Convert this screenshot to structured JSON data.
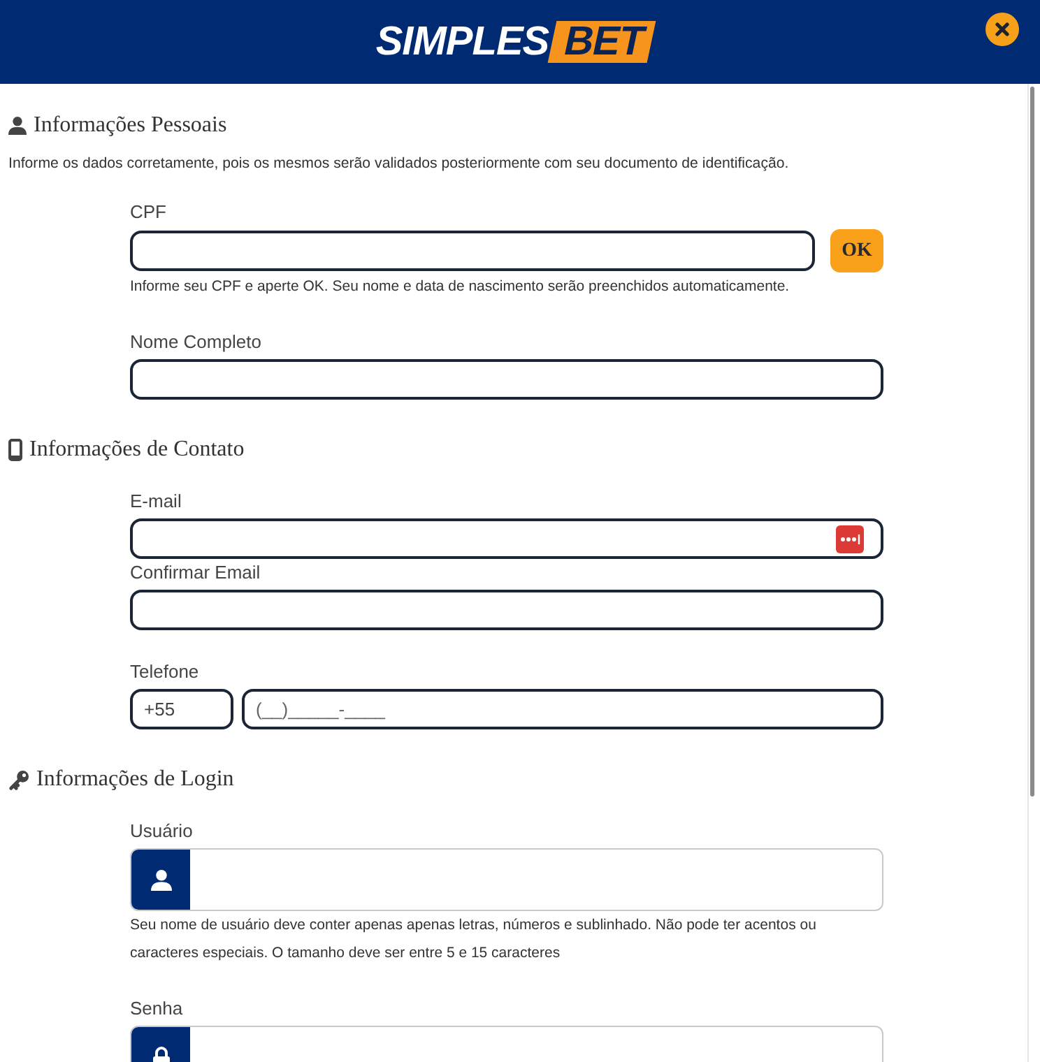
{
  "header": {
    "logo_main": "SIMPLES",
    "logo_accent": "BET"
  },
  "personal_info": {
    "title": "Informações Pessoais",
    "description": "Informe os dados corretamente, pois os mesmos serão validados posteriormente com seu documento de identificação.",
    "fields": [
      {
        "kind": "input_button",
        "label": "CPF",
        "button": "OK",
        "hint": "Informe seu CPF e aperte OK. Seu nome e data de nascimento serão preenchidos automaticamente."
      },
      {
        "kind": "input",
        "label": "Nome Completo"
      }
    ]
  },
  "contact_info": {
    "title": "Informações de Contato",
    "fields": [
      {
        "kind": "input",
        "label": "E-mail",
        "autofill_icon": true
      },
      {
        "kind": "input",
        "label": "Confirmar Email"
      },
      {
        "kind": "phone",
        "label": "Telefone",
        "country_code": "+55",
        "placeholder": "(__)_____-____"
      }
    ]
  },
  "login_info": {
    "title": "Informações de Login",
    "fields": [
      {
        "kind": "user_input",
        "label": "Usuário",
        "hint": "Seu nome de usuário deve conter apenas apenas letras, números e sublinhado. Não pode ter acentos ou caracteres especiais. O tamanho deve ser entre 5 e 15 caracteres"
      },
      {
        "kind": "password_input",
        "label": "Senha"
      }
    ]
  }
}
